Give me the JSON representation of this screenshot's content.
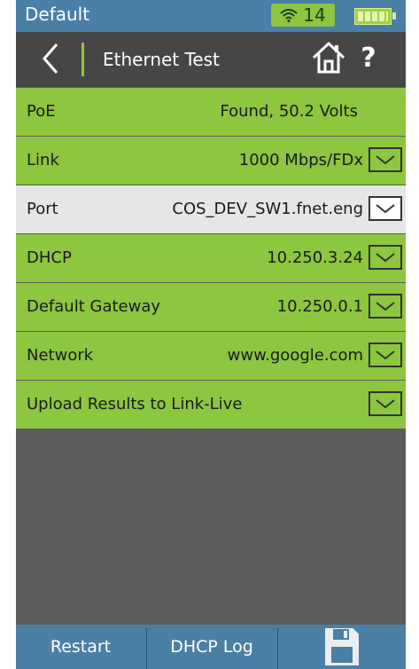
{
  "status": {
    "profile": "Default",
    "wifi_count": "14"
  },
  "header": {
    "title": "Ethernet Test"
  },
  "rows": [
    {
      "label": "PoE",
      "value": "Found, 50.2 Volts"
    },
    {
      "label": "Link",
      "value": "1000 Mbps/FDx"
    },
    {
      "label": "Port",
      "value": "COS_DEV_SW1.fnet.eng"
    },
    {
      "label": "DHCP",
      "value": "10.250.3.24"
    },
    {
      "label": "Default Gateway",
      "value": "10.250.0.1"
    },
    {
      "label": "Network",
      "value": "www.google.com"
    },
    {
      "label": "Upload Results to Link-Live",
      "value": ""
    }
  ],
  "bottom": {
    "restart": "Restart",
    "dhcp_log": "DHCP Log"
  },
  "colors": {
    "accent": "#8dc63f",
    "bar": "#4a7fa6",
    "header": "#464646",
    "selected": "#e6e6e6"
  },
  "icons": {
    "back": "chevron-left-icon",
    "home": "home-icon",
    "help": "help-icon",
    "save": "floppy-disk-icon",
    "wifi": "wifi-icon",
    "battery": "battery-icon"
  }
}
